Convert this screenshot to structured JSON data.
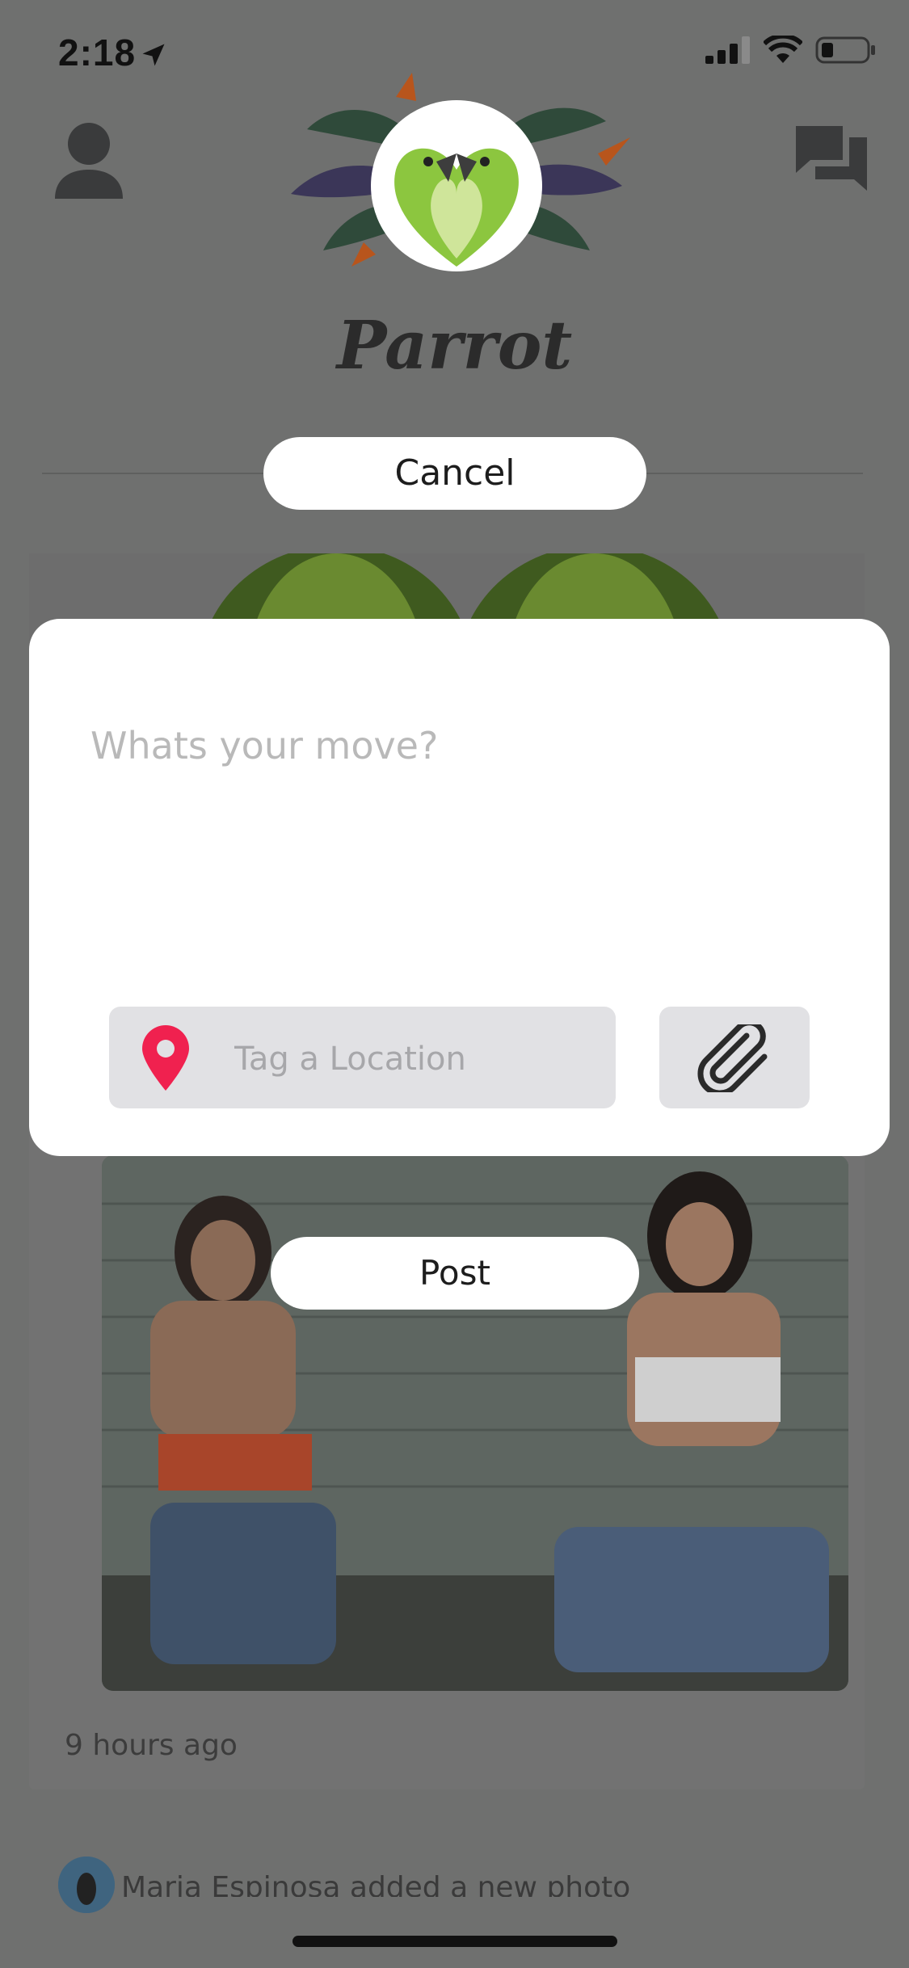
{
  "status_bar": {
    "time": "2:18"
  },
  "app": {
    "name": "Parrot"
  },
  "header": {
    "cancel_label": "Cancel"
  },
  "compose": {
    "placeholder": "Whats your move?",
    "location_placeholder": "Tag a Location",
    "post_label": "Post"
  },
  "feed": {
    "timestamp": "9 hours ago",
    "next_item_text": "Maria Espinosa added a new photo"
  },
  "icons": {
    "profile": "person-icon",
    "chat": "chat-bubbles-icon",
    "location": "map-pin-icon",
    "attach": "paperclip-icon"
  },
  "colors": {
    "overlay": "#6f706f",
    "accent_pin": "#f0214f",
    "field_bg": "#e1e1e4",
    "logo_green": "#8cc63f"
  }
}
